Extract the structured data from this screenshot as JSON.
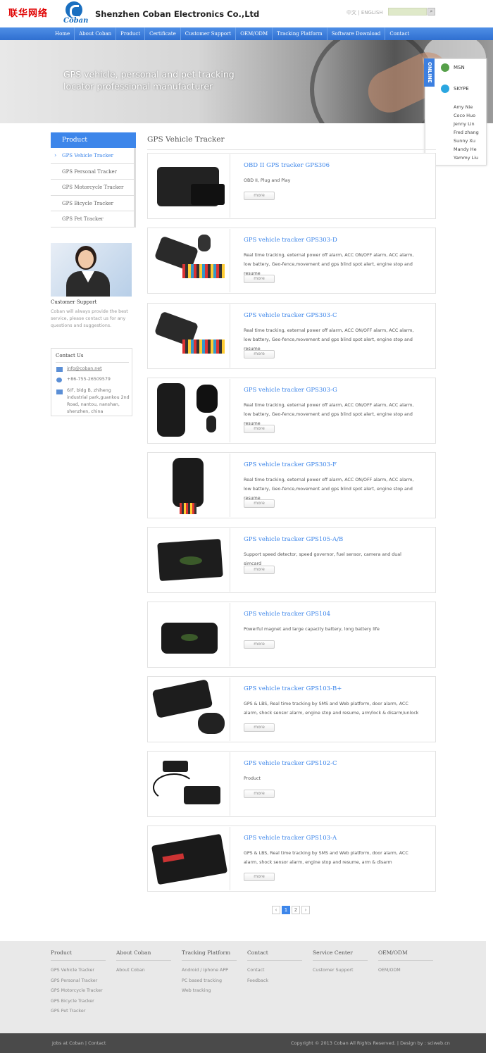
{
  "watermark": "联华网络",
  "header": {
    "brand": "Coban",
    "company": "Shenzhen Coban Electronics Co.,Ltd",
    "lang_cn": "中文",
    "lang_sep": "|",
    "lang_en": "ENGLISH"
  },
  "nav": [
    "Home",
    "About Coban",
    "Product",
    "Certificate",
    "Customer Support",
    "OEM/ODM",
    "Tracking Platform",
    "Software Download",
    "Contact"
  ],
  "banner": {
    "line1": "GPS vehicle, personal and pet tracking",
    "line2": "locator professional manufacturer"
  },
  "online": {
    "tab": "ONLINE",
    "msn": "MSN",
    "skype": "SKYPE",
    "names": [
      "Amy Nie",
      "Coco Huo",
      "Jenny Lin",
      "Fred zhang",
      "Sunny Xu",
      "Mandy He",
      "Yammy Liu"
    ]
  },
  "sidebar": {
    "title": "Product",
    "items": [
      "GPS Vehicle Tracker",
      "GPS Personal Tracker",
      "GPS Motorcycle Tracker",
      "GPS Bicycle Tracker",
      "GPS Pet Tracker"
    ],
    "support_title": "Customer Support",
    "support_desc": "Coban will always provide the best service, please contact us for any questions and suggestions.",
    "contact_title": "Contact Us",
    "email": "info@coban.net",
    "phone": "+86-755-26509579",
    "address": "6/F, bldg B, zhiheng industrial park,guankou 2nd Road, nantou, nanshan, shenzhen, china"
  },
  "content_title": "GPS Vehicle Tracker",
  "more_label": "more",
  "products": [
    {
      "title": "OBD II GPS tracker GPS306",
      "desc": "OBD II, Plug and Play"
    },
    {
      "title": "GPS vehicle tracker GPS303-D",
      "desc": "Real time tracking, external power off alarm, ACC ON/OFF alarm, ACC alarm, low battery, Geo-fence,movement and gps blind spot alert, engine stop and resume"
    },
    {
      "title": "GPS vehicle tracker GPS303-C",
      "desc": "Real time tracking, external power off alarm, ACC ON/OFF alarm, ACC alarm, low battery, Geo-fence,movement and gps blind spot alert, engine stop and resume"
    },
    {
      "title": "GPS vehicle tracker GPS303-G",
      "desc": "Real time tracking, external power off alarm, ACC ON/OFF alarm, ACC alarm, low battery, Geo-fence,movement and gps blind spot alert, engine stop and resume"
    },
    {
      "title": "GPS vehicle tracker GPS303-F",
      "desc": "Real time tracking, external power off alarm, ACC ON/OFF alarm, ACC alarm, low battery, Geo-fence,movement and gps blind spot alert, engine stop and resume"
    },
    {
      "title": "GPS vehicle tracker GPS105-A/B",
      "desc": "Support speed detector, speed governor, fuel sensor, camera and dual simcard"
    },
    {
      "title": "GPS vehicle tracker GPS104",
      "desc": "Powerful magnet and large capacity battery, long battery life"
    },
    {
      "title": "GPS vehicle tracker GPS103-B+",
      "desc": "GPS & LBS, Real time tracking by SMS and Web platform, door alarm, ACC alarm, shock sensor alarm, engine stop and resume, arm/lock & disarm/unlock"
    },
    {
      "title": "GPS vehicle tracker GPS102-C",
      "desc": "Product"
    },
    {
      "title": "GPS vehicle tracker GPS103-A",
      "desc": "GPS & LBS, Real time tracking by SMS and Web platform, door alarm, ACC alarm, shock sensor alarm, engine stop and resume, arm & disarm"
    }
  ],
  "pager": {
    "prev": "‹",
    "pages": [
      "1",
      "2"
    ],
    "next": "›"
  },
  "footer": {
    "cols": [
      {
        "title": "Product",
        "links": [
          "GPS Vehicle Tracker",
          "GPS Personal Tracker",
          "GPS Motorcycle Tracker",
          "GPS Bicycle Tracker",
          "GPS Pet Tracker"
        ]
      },
      {
        "title": "About Coban",
        "links": [
          "About Coban"
        ]
      },
      {
        "title": "Tracking Platform",
        "links": [
          "Android / Iphone APP",
          "PC based tracking",
          "Web tracking"
        ]
      },
      {
        "title": "Contact",
        "links": [
          "Contact",
          "Feedback"
        ]
      },
      {
        "title": "Service Center",
        "links": [
          "Customer Support"
        ]
      },
      {
        "title": "OEM/ODM",
        "links": [
          "OEM/ODM"
        ]
      }
    ],
    "bottom_left": "Jobs at Coban  |  Contact",
    "bottom_right": "Copyright © 2013 Coban All Rights Reserved. | Design by : sciweb.cn"
  },
  "colors": {
    "accent": "#3d86ea",
    "nav": "#3a7ad8",
    "footer": "#e9e9e9",
    "bottom": "#4a4a4a"
  }
}
